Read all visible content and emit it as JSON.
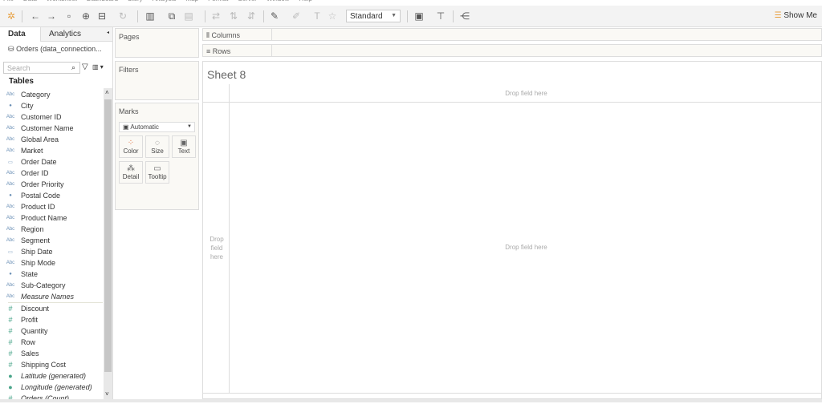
{
  "menu": [
    "File",
    "Data",
    "Worksheet",
    "Dashboard",
    "Story",
    "Analysis",
    "Map",
    "Format",
    "Server",
    "Window",
    "Help"
  ],
  "toolbar": {
    "mark_type_select": "Standard",
    "show_me": "Show Me"
  },
  "left": {
    "tabs": [
      "Data",
      "Analytics"
    ],
    "datasource": "Orders (data_connection...",
    "search_placeholder": "Search",
    "tables_heading": "Tables",
    "dimensions": [
      {
        "label": "Category",
        "icon": "abc"
      },
      {
        "label": "City",
        "icon": "globe"
      },
      {
        "label": "Customer ID",
        "icon": "abc"
      },
      {
        "label": "Customer Name",
        "icon": "abc"
      },
      {
        "label": "Global Area",
        "icon": "abc"
      },
      {
        "label": "Market",
        "icon": "abc"
      },
      {
        "label": "Order Date",
        "icon": "calendar"
      },
      {
        "label": "Order ID",
        "icon": "abc"
      },
      {
        "label": "Order Priority",
        "icon": "abc"
      },
      {
        "label": "Postal Code",
        "icon": "globe"
      },
      {
        "label": "Product ID",
        "icon": "abc"
      },
      {
        "label": "Product Name",
        "icon": "abc"
      },
      {
        "label": "Region",
        "icon": "abc"
      },
      {
        "label": "Segment",
        "icon": "abc"
      },
      {
        "label": "Ship Date",
        "icon": "calendar"
      },
      {
        "label": "Ship Mode",
        "icon": "abc"
      },
      {
        "label": "State",
        "icon": "globe"
      },
      {
        "label": "Sub-Category",
        "icon": "abc"
      },
      {
        "label": "Measure Names",
        "icon": "abc",
        "italic": true
      }
    ],
    "measures": [
      {
        "label": "Discount",
        "icon": "number"
      },
      {
        "label": "Profit",
        "icon": "number"
      },
      {
        "label": "Quantity",
        "icon": "number"
      },
      {
        "label": "Row",
        "icon": "number"
      },
      {
        "label": "Sales",
        "icon": "number"
      },
      {
        "label": "Shipping Cost",
        "icon": "number"
      },
      {
        "label": "Latitude (generated)",
        "icon": "globe",
        "italic": true
      },
      {
        "label": "Longitude (generated)",
        "icon": "globe",
        "italic": true
      },
      {
        "label": "Orders (Count)",
        "icon": "number",
        "italic": true
      }
    ]
  },
  "cards": {
    "pages": "Pages",
    "filters": "Filters",
    "marks": "Marks",
    "mark_type": "Automatic",
    "buttons": [
      "Color",
      "Size",
      "Text",
      "Detail",
      "Tooltip"
    ]
  },
  "shelves": {
    "columns": "Columns",
    "rows": "Rows"
  },
  "sheet": {
    "title": "Sheet 8",
    "drop_top": "Drop field here",
    "drop_center": "Drop field here",
    "drop_left": "Drop field here"
  }
}
